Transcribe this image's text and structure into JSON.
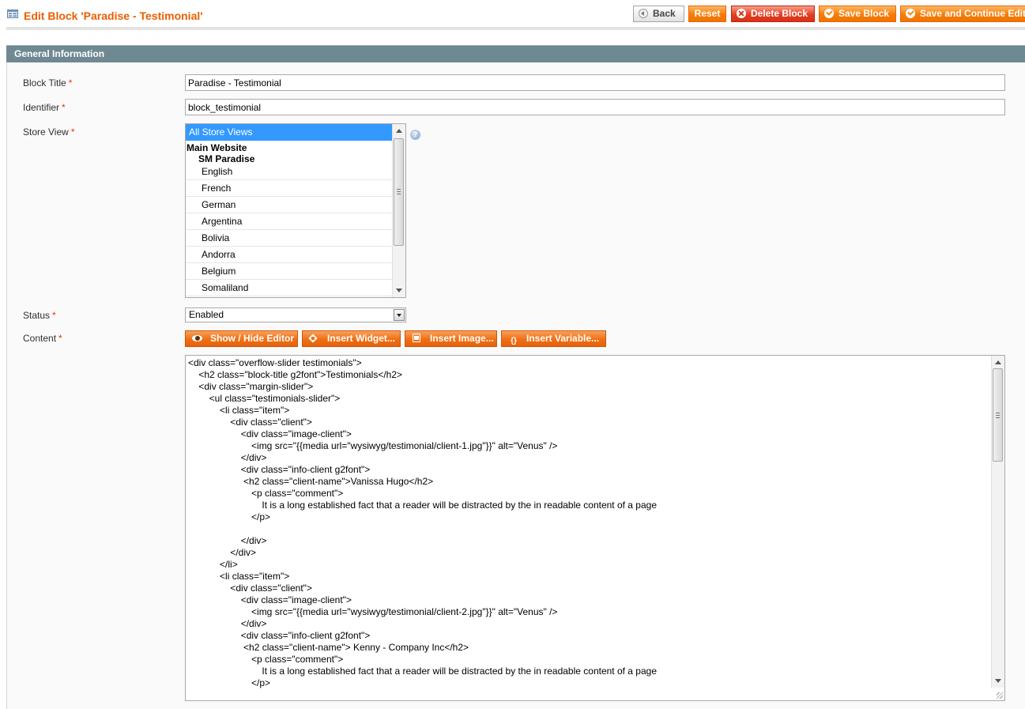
{
  "header": {
    "title": "Edit Block 'Paradise - Testimonial'",
    "icon": "cms-block-icon",
    "buttons": {
      "back": "Back",
      "reset": "Reset",
      "delete": "Delete Block",
      "save": "Save Block",
      "save_continue": "Save and Continue Edit"
    }
  },
  "section": {
    "title": "General Information"
  },
  "form": {
    "block_title": {
      "label": "Block Title",
      "value": "Paradise - Testimonial"
    },
    "identifier": {
      "label": "Identifier",
      "value": "block_testimonial"
    },
    "store_view": {
      "label": "Store View",
      "selected": "All Store Views",
      "website": "Main Website",
      "store": "SM Paradise",
      "options": [
        "English",
        "French",
        "German",
        "Argentina",
        "Bolivia",
        "Andorra",
        "Belgium",
        "Somaliland"
      ]
    },
    "status": {
      "label": "Status",
      "value": "Enabled"
    },
    "content": {
      "label": "Content",
      "buttons": {
        "show_hide": "Show / Hide Editor",
        "insert_widget": "Insert Widget...",
        "insert_image": "Insert Image...",
        "insert_variable": "Insert Variable..."
      },
      "text": "<div class=\"overflow-slider testimonials\">\n\t<h2 class=\"block-title g2font\">Testimonials</h2>\n\t<div class=\"margin-slider\">\n\t\t<ul class=\"testimonials-slider\">\n\t\t\t<li class=\"item\">\n\t\t\t\t<div class=\"client\">\n\t\t\t\t\t<div class=\"image-client\">\n\t\t\t\t\t\t<img src=\"{{media url=\"wysiwyg/testimonial/client-1.jpg\"}}\" alt=\"Venus\" />\n\t\t\t\t\t</div>\n\t\t\t\t\t<div class=\"info-client g2font\">\n\t\t\t\t\t <h2 class=\"client-name\">Vanissa Hugo</h2>\n\t\t\t\t\t\t<p class=\"comment\">\n\t\t\t\t\t\t\tIt is a long established fact that a reader will be distracted by the in readable content of a page\n\t\t\t\t\t\t</p>\n\n\t\t\t\t\t</div>\n\t\t\t\t</div>\n\t\t\t</li>\n\t\t\t<li class=\"item\">\n\t\t\t\t<div class=\"client\">\n\t\t\t\t\t<div class=\"image-client\">\n\t\t\t\t\t\t<img src=\"{{media url=\"wysiwyg/testimonial/client-2.jpg\"}}\" alt=\"Venus\" />\n\t\t\t\t\t</div>\n\t\t\t\t\t<div class=\"info-client g2font\">\n\t\t\t\t\t <h2 class=\"client-name\"> Kenny - Company Inc</h2>\n\t\t\t\t\t\t<p class=\"comment\">\n\t\t\t\t\t\t\tIt is a long established fact that a reader will be distracted by the in readable content of a page\n\t\t\t\t\t\t</p>"
    }
  },
  "required_marker": "*",
  "help_icon": "?",
  "colors": {
    "title_orange": "#eb5e00",
    "button_orange": "#f67c06",
    "delete_red": "#e33e22",
    "section_header": "#6f8992",
    "selected_option": "#3399ff",
    "required_red": "#eb340a"
  }
}
